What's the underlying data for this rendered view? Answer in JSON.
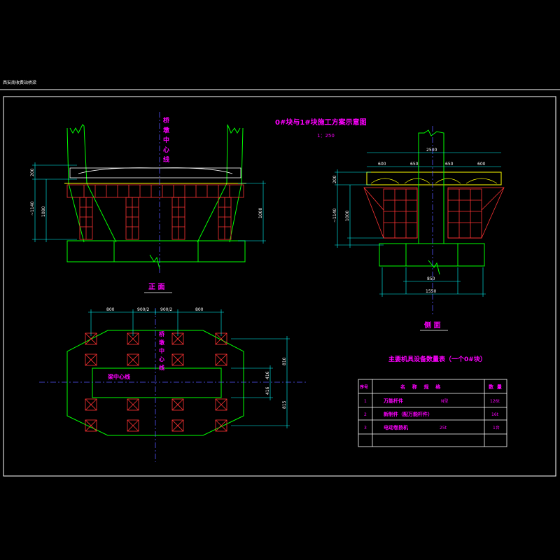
{
  "header_note": "西安南收费站桥梁",
  "title": "0#块与1#块施工方案示意图",
  "scale": "1：250",
  "views": {
    "front_label": "正  面",
    "side_label": "侧  面"
  },
  "centerline_labels": {
    "bridge_center": [
      "桥",
      "墩",
      "中",
      "心",
      "线"
    ],
    "bridge_center_plan": [
      "桥",
      "墩",
      "中",
      "心",
      "线"
    ],
    "beam_center": "梁中心线"
  },
  "front_dims": {
    "top": "200",
    "total": "~1140",
    "height": "1080",
    "right": "1000"
  },
  "side_dims": {
    "width_total": "2500",
    "segments": [
      "600",
      "650",
      "650",
      "600"
    ],
    "top": "200",
    "total": "~1140",
    "height": "1000",
    "base_inner": "850",
    "base_outer": "1550"
  },
  "plan_dims": {
    "top_segments": [
      "800",
      "900/2",
      "900/2",
      "800"
    ],
    "right_outer_top": "810",
    "right_inner_top": "416",
    "right_inner_bottom": "416",
    "right_outer_bottom": "815"
  },
  "table": {
    "title": "主要机具设备数量表（一个0#块）",
    "headers": [
      "序号",
      "名    称    规    格",
      "数  量"
    ],
    "rows": [
      {
        "no": "1",
        "name": "万能杆件",
        "spec": "N型",
        "qty": "126t"
      },
      {
        "no": "2",
        "name": "新制件（配万能杆件）",
        "spec": "",
        "qty": "16t"
      },
      {
        "no": "3",
        "name": "电动卷扬机",
        "spec": "25t",
        "qty": "1台"
      },
      {
        "no": "",
        "name": "",
        "spec": "",
        "qty": ""
      }
    ]
  }
}
